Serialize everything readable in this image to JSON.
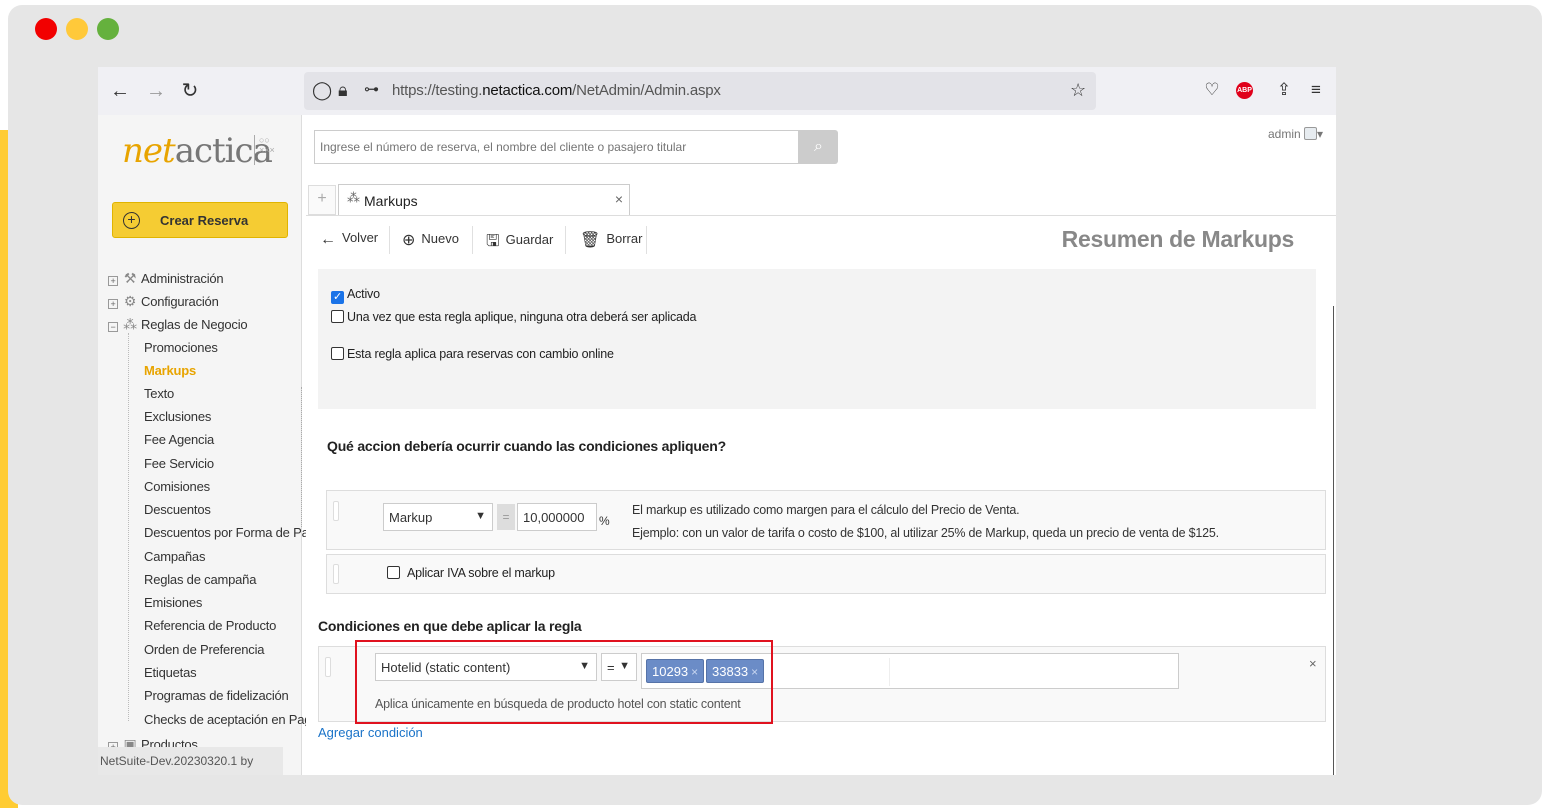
{
  "browser": {
    "url_prefix": "https://testing.",
    "url_domain": "netactica.com",
    "url_path": "/NetAdmin/Admin.aspx"
  },
  "logo": {
    "part1": "net",
    "part2": "actica"
  },
  "sidebar": {
    "create_button": "Crear Reserva",
    "sections": [
      {
        "label": "Administración"
      },
      {
        "label": "Configuración"
      },
      {
        "label": "Reglas de Negocio"
      }
    ],
    "sub_items": [
      "Promociones",
      "Markups",
      "Texto",
      "Exclusiones",
      "Fee Agencia",
      "Fee Servicio",
      "Comisiones",
      "Descuentos",
      "Descuentos por Forma de Pa",
      "Campañas",
      "Reglas de campaña",
      "Emisiones",
      "Referencia de Producto",
      "Orden de Preferencia",
      "Etiquetas",
      "Programas de fidelización",
      "Checks de aceptación en Pag"
    ],
    "products_label": "Productos",
    "version": "NetSuite-Dev.20230320.1 by"
  },
  "search": {
    "placeholder": "Ingrese el número de reserva, el nombre del cliente o pasajero titular"
  },
  "user": {
    "name": "admin"
  },
  "tabs": [
    {
      "label": "Markups"
    }
  ],
  "toolbar": {
    "back": "Volver",
    "new": "Nuevo",
    "save": "Guardar",
    "delete": "Borrar"
  },
  "page_title": "Resumen de Markups",
  "options": {
    "active": "Activo",
    "exclusive": "Una vez que esta regla aplique, ninguna otra deberá ser aplicada",
    "online_change": "Esta regla aplica para reservas con cambio online"
  },
  "action_section": {
    "heading": "Qué accion debería ocurrir cuando las condiciones apliquen?",
    "type_value": "Markup",
    "operator": "=",
    "amount": "10,000000",
    "unit": "%",
    "info_line1": "El markup es utilizado como margen para el cálculo del Precio de Venta.",
    "info_line2": "Ejemplo: con un valor de tarifa o costo de $100, al utilizar 25% de Markup, queda un precio de venta de $125.",
    "vat_label": "Aplicar IVA sobre el markup"
  },
  "conditions": {
    "heading": "Condiciones en que debe aplicar la regla",
    "field": "Hotelid (static content)",
    "operator": "=",
    "tags": [
      "10293",
      "33833"
    ],
    "hint": "Aplica únicamente en búsqueda de producto hotel con static content",
    "add_link": "Agregar condición"
  }
}
